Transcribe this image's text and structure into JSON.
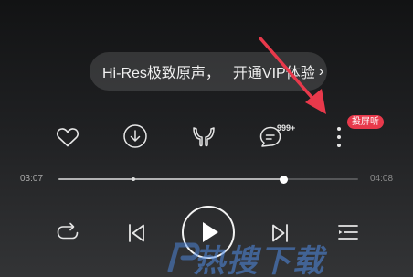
{
  "promo": {
    "text_left": "Hi-Res极致原声，",
    "text_right": "开通VIP体验",
    "chevron": "›"
  },
  "actions": {
    "comment_count": "999+",
    "cast_badge": "投屏听"
  },
  "progress": {
    "elapsed": "03:07",
    "total": "04:08",
    "fraction": 0.75
  },
  "icons": [
    "heart-icon",
    "download-icon",
    "tune-icon",
    "comment-icon",
    "more-icon",
    "repeat-icon",
    "previous-icon",
    "play-icon",
    "next-icon",
    "playlist-icon"
  ],
  "colors": {
    "badge": "#e8394b",
    "arrow": "#e8394b",
    "watermark": "#508ce6"
  },
  "watermark": {
    "text": "热搜下载"
  }
}
